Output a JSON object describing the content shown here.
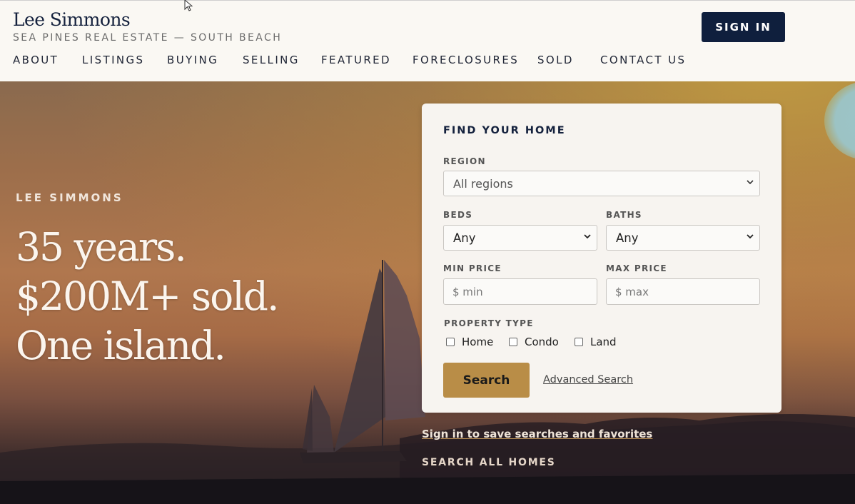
{
  "brand": {
    "name": "Lee Simmons",
    "tagline": "SEA PINES REAL ESTATE — SOUTH BEACH"
  },
  "header": {
    "signin_label": "SIGN IN"
  },
  "nav": {
    "items": [
      "ABOUT",
      "LISTINGS",
      "BUYING",
      "SELLING",
      "FEATURED",
      "FORECLOSURES",
      "SOLD",
      "CONTACT US"
    ]
  },
  "hero": {
    "eyebrow": "LEE SIMMONS",
    "title_lines": [
      "35 years.",
      "$200M+ sold.",
      "One island."
    ]
  },
  "search_card": {
    "title": "FIND YOUR HOME",
    "region": {
      "label": "REGION",
      "value": "All regions"
    },
    "beds": {
      "label": "BEDS",
      "value": "Any"
    },
    "baths": {
      "label": "BATHS",
      "value": "Any"
    },
    "min_price": {
      "label": "MIN PRICE",
      "placeholder": "$ min"
    },
    "max_price": {
      "label": "MAX PRICE",
      "placeholder": "$ max"
    },
    "property_type": {
      "label": "PROPERTY TYPE",
      "options": [
        "Home",
        "Condo",
        "Land"
      ]
    },
    "search_label": "Search",
    "advanced_label": "Advanced Search"
  },
  "links": {
    "save_searches": "Sign in to save searches and favorites",
    "all_homes": "SEARCH ALL HOMES"
  },
  "colors": {
    "navy": "#0f1f3d",
    "gold": "#b98d47",
    "cream": "#faf8f3"
  }
}
